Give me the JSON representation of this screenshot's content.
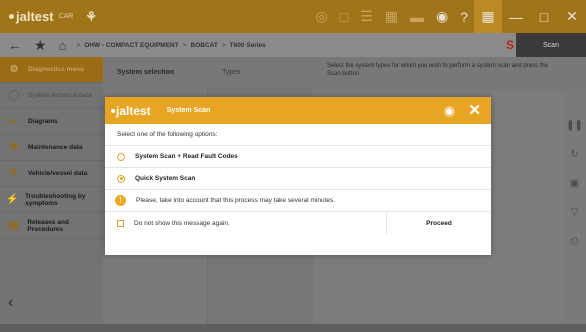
{
  "app": {
    "logo": "jaltest",
    "logo_sub": "CAR",
    "brand_network_icon": "network-icon"
  },
  "topbar": {
    "icons": [
      "globe-icon",
      "document-icon",
      "list-icon",
      "vehicle-icon",
      "battery-icon",
      "camera-icon",
      "help-icon"
    ],
    "help_label": "?"
  },
  "breadcrumb": {
    "items": [
      "OHW - COMPACT EQUIPMENT",
      "BOBCAT",
      "T600 Series"
    ],
    "separator": ">",
    "scan_label": "Scan"
  },
  "sidebar": {
    "items": [
      {
        "label": "Diagnostics menu",
        "icon": "diagnostics-icon",
        "active": true
      },
      {
        "label": "System technical data",
        "icon": "clock-icon",
        "dark": true
      },
      {
        "label": "Diagrams",
        "icon": "diagram-icon"
      },
      {
        "label": "Maintenance data",
        "icon": "wrench-icon"
      },
      {
        "label": "Vehicle/vessel data",
        "icon": "vehicle-data-icon"
      },
      {
        "label": "Troubleshooting by symptoms",
        "icon": "troubleshoot-icon"
      },
      {
        "label": "Releases and Procedures",
        "icon": "book-icon"
      }
    ]
  },
  "columns": {
    "system_selection": "System selection",
    "types": "Types",
    "description": "Select the system types for which you wish to perform a system scan and press the Scan button"
  },
  "modal": {
    "logo": "jaltest",
    "title": "System Scan",
    "instruction": "Select one of the following options:",
    "options": [
      {
        "label": "System Scan + Read Fault Codes",
        "selected": false
      },
      {
        "label": "Quick System Scan",
        "selected": true
      }
    ],
    "warning": "Please, take into account that this process may take several minutes.",
    "dont_show": "Do not show this message again.",
    "proceed": "Proceed"
  },
  "colors": {
    "accent": "#e8a524",
    "topbar": "#a07419",
    "overlay": "#7d7d7d"
  }
}
